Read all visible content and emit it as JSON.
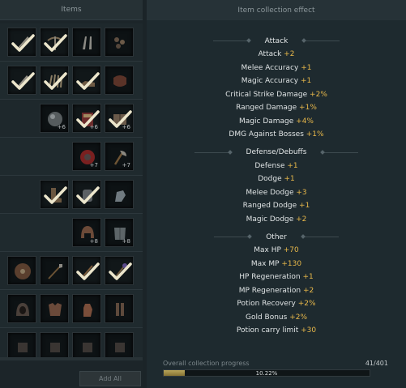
{
  "items_panel": {
    "header": "Items",
    "add_all_label": "Add All",
    "rows": [
      {
        "slots": [
          {
            "icon": "sword-icon",
            "collected": true,
            "plus": ""
          },
          {
            "icon": "crossbow-icon",
            "collected": true,
            "plus": ""
          },
          {
            "icon": "dagger-pair-icon",
            "collected": false,
            "plus": ""
          },
          {
            "icon": "beads-icon",
            "collected": false,
            "plus": ""
          }
        ]
      },
      {
        "slots": [
          {
            "icon": "dagger-icon",
            "collected": true,
            "plus": ""
          },
          {
            "icon": "claw-icon",
            "collected": true,
            "plus": ""
          },
          {
            "icon": "shoes-icon",
            "collected": true,
            "plus": ""
          },
          {
            "icon": "scroll-icon",
            "collected": false,
            "plus": ""
          }
        ]
      },
      {
        "slots": [
          {
            "icon": "orb-icon",
            "collected": false,
            "plus": "+6"
          },
          {
            "icon": "tome-icon",
            "collected": true,
            "plus": "+6"
          },
          {
            "icon": "book-icon",
            "collected": true,
            "plus": "+6"
          }
        ]
      },
      {
        "slots": [
          {
            "icon": "red-shield-icon",
            "collected": false,
            "plus": "+7"
          },
          {
            "icon": "axe-icon",
            "collected": false,
            "plus": "+7"
          }
        ]
      },
      {
        "slots": [
          {
            "icon": "boots-icon",
            "collected": true,
            "plus": ""
          },
          {
            "icon": "bracer-icon",
            "collected": true,
            "plus": ""
          },
          {
            "icon": "gauntlet-icon",
            "collected": false,
            "plus": ""
          }
        ]
      },
      {
        "slots": [
          {
            "icon": "helmet-icon",
            "collected": false,
            "plus": "+8"
          },
          {
            "icon": "breastplate-icon",
            "collected": false,
            "plus": "+8"
          }
        ]
      },
      {
        "slots": [
          {
            "icon": "round-shield-icon",
            "collected": false,
            "plus": ""
          },
          {
            "icon": "spear-icon",
            "collected": false,
            "plus": ""
          },
          {
            "icon": "wand-icon",
            "collected": true,
            "plus": ""
          },
          {
            "icon": "staff-icon",
            "collected": true,
            "plus": ""
          }
        ]
      },
      {
        "slots": [
          {
            "icon": "hood-icon",
            "collected": false,
            "plus": ""
          },
          {
            "icon": "cuirass-icon",
            "collected": false,
            "plus": ""
          },
          {
            "icon": "glove-icon",
            "collected": false,
            "plus": ""
          },
          {
            "icon": "greaves-icon",
            "collected": false,
            "plus": ""
          }
        ]
      },
      {
        "slots": [
          {
            "icon": "item-icon",
            "collected": false,
            "plus": ""
          },
          {
            "icon": "item-icon",
            "collected": false,
            "plus": ""
          },
          {
            "icon": "item-icon",
            "collected": false,
            "plus": ""
          },
          {
            "icon": "item-icon",
            "collected": false,
            "plus": ""
          }
        ]
      }
    ]
  },
  "effect_panel": {
    "header": "Item collection effect",
    "sections": [
      {
        "title": "Attack",
        "stats": [
          {
            "label": "Attack",
            "value": "+2"
          },
          {
            "label": "Melee Accuracy",
            "value": "+1"
          },
          {
            "label": "Magic Accuracy",
            "value": "+1"
          },
          {
            "label": "Critical Strike Damage",
            "value": "+2%"
          },
          {
            "label": "Ranged Damage",
            "value": "+1%"
          },
          {
            "label": "Magic Damage",
            "value": "+4%"
          },
          {
            "label": "DMG Against Bosses",
            "value": "+1%"
          }
        ]
      },
      {
        "title": "Defense/Debuffs",
        "stats": [
          {
            "label": "Defense",
            "value": "+1"
          },
          {
            "label": "Dodge",
            "value": "+1"
          },
          {
            "label": "Melee Dodge",
            "value": "+3"
          },
          {
            "label": "Ranged Dodge",
            "value": "+1"
          },
          {
            "label": "Magic Dodge",
            "value": "+2"
          }
        ]
      },
      {
        "title": "Other",
        "stats": [
          {
            "label": "Max HP",
            "value": "+70"
          },
          {
            "label": "Max MP",
            "value": "+130"
          },
          {
            "label": "HP Regeneration",
            "value": "+1"
          },
          {
            "label": "MP Regeneration",
            "value": "+2"
          },
          {
            "label": "Potion Recovery",
            "value": "+2%"
          },
          {
            "label": "Gold Bonus",
            "value": "+2%"
          },
          {
            "label": "Potion carry limit",
            "value": "+30"
          }
        ]
      }
    ],
    "progress": {
      "label": "Overall collection progress",
      "count": "41/401",
      "percent_text": "10.22%",
      "fraction": 0.1022
    }
  },
  "colors": {
    "accent_value": "#e8b84a",
    "check": "#ece6cc",
    "progress_fill": "#b8a55a"
  }
}
